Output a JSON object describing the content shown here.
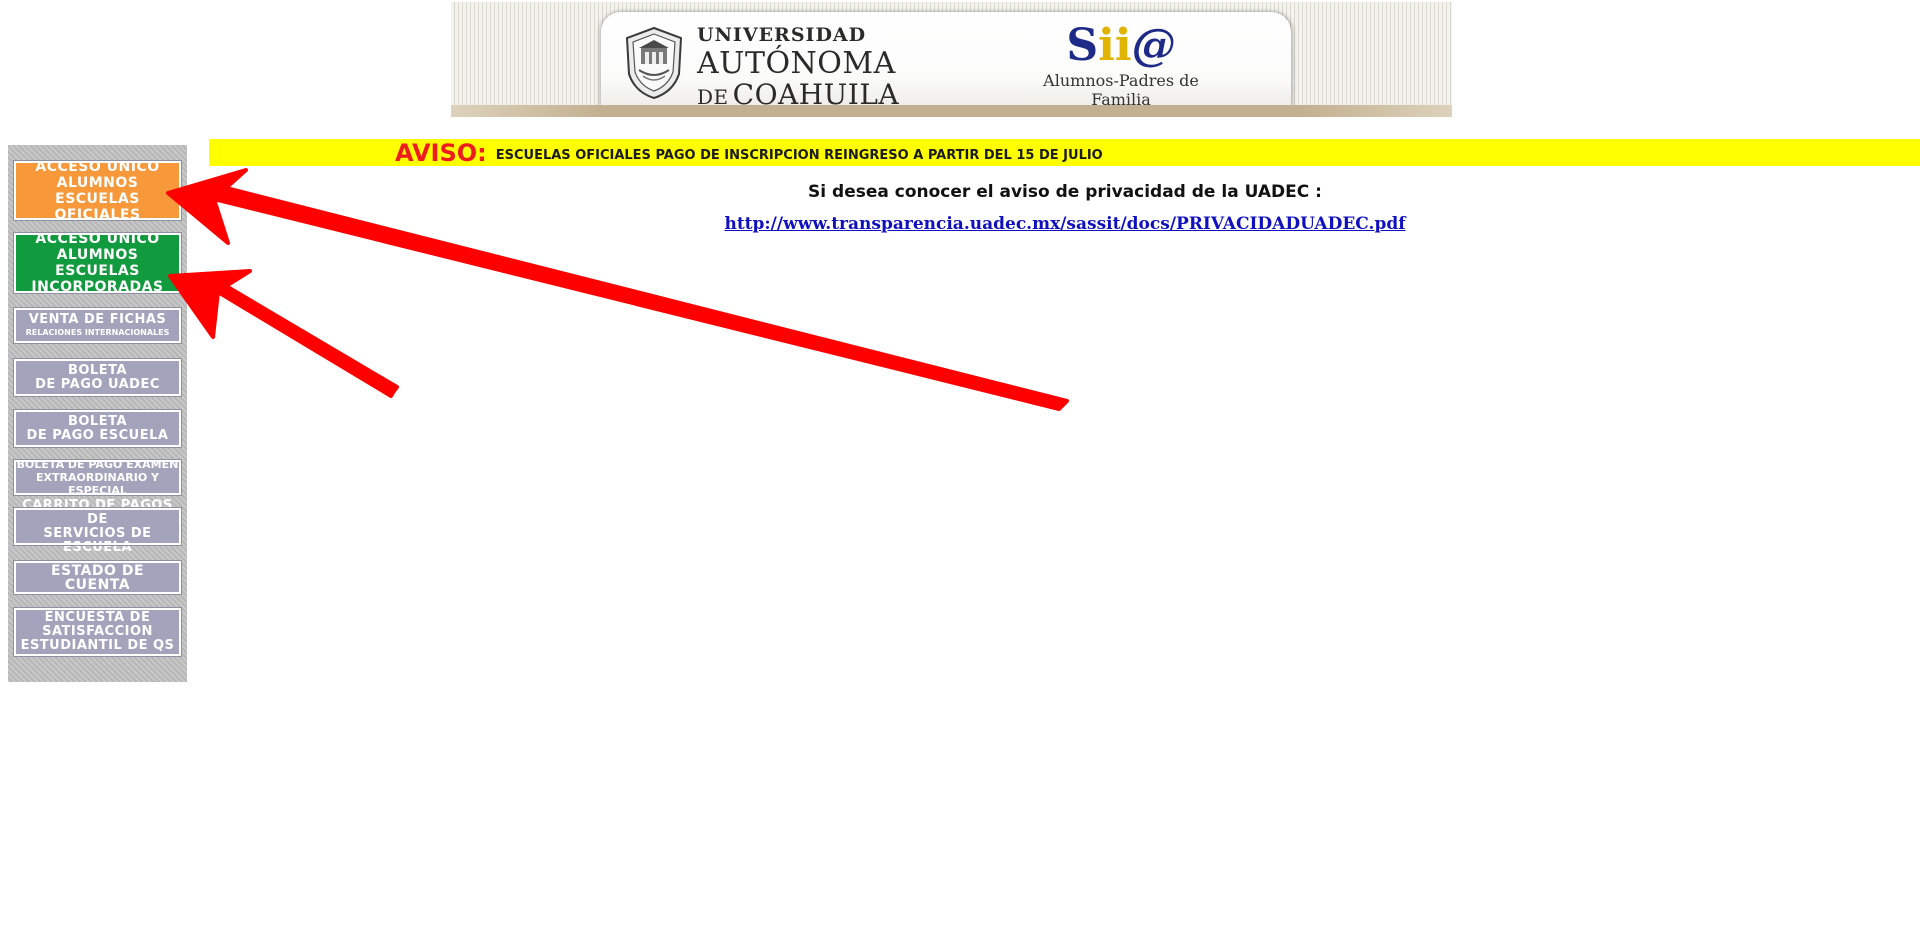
{
  "header": {
    "university": {
      "line1": "UNIVERSIDAD",
      "line2": "AUTÓNOMA",
      "line3_prefix": "DE",
      "line3": "COAHUILA"
    },
    "sia": {
      "logo_s": "S",
      "logo_ii": "ii",
      "logo_at": "@",
      "subtitle": "Alumnos-Padres de Familia"
    }
  },
  "menu": {
    "items": [
      {
        "lines": [
          "ACCESO UNICO",
          "ALUMNOS ESCUELAS",
          "OFICIALES"
        ],
        "color": "#f7993a"
      },
      {
        "lines": [
          "ACCESO UNICO",
          "ALUMNOS ESCUELAS",
          "INCORPORADAS"
        ],
        "color": "#119a3e"
      },
      {
        "lines": [
          "VENTA DE FICHAS",
          "RELACIONES INTERNACIONALES"
        ]
      },
      {
        "lines": [
          "BOLETA",
          "DE PAGO UADEC"
        ]
      },
      {
        "lines": [
          "BOLETA",
          "DE PAGO ESCUELA"
        ]
      },
      {
        "lines": [
          "BOLETA DE PAGO EXAMEN",
          "EXTRAORDINARIO Y ESPECIAL"
        ]
      },
      {
        "lines": [
          "CARRITO DE PAGOS DE",
          "SERVICIOS DE ESCUELA"
        ]
      },
      {
        "lines": [
          "ESTADO DE CUENTA"
        ]
      },
      {
        "lines": [
          "ENCUESTA DE",
          "SATISFACCION",
          "ESTUDIANTIL DE QS"
        ]
      }
    ]
  },
  "notice": {
    "label": "AVISO:",
    "text": "ESCUELAS OFICIALES PAGO DE INSCRIPCION REINGRESO A PARTIR DEL 15 DE JULIO"
  },
  "privacy": {
    "text": "Si desea conocer el aviso de privacidad de la UADEC :",
    "link": "http://www.transparencia.uadec.mx/sassit/docs/PRIVACIDADUADEC.pdf"
  },
  "colors": {
    "notice_bg": "#ffff00",
    "notice_label": "#ee1c1c",
    "arrow": "#ff0000",
    "link": "#1010c0"
  }
}
